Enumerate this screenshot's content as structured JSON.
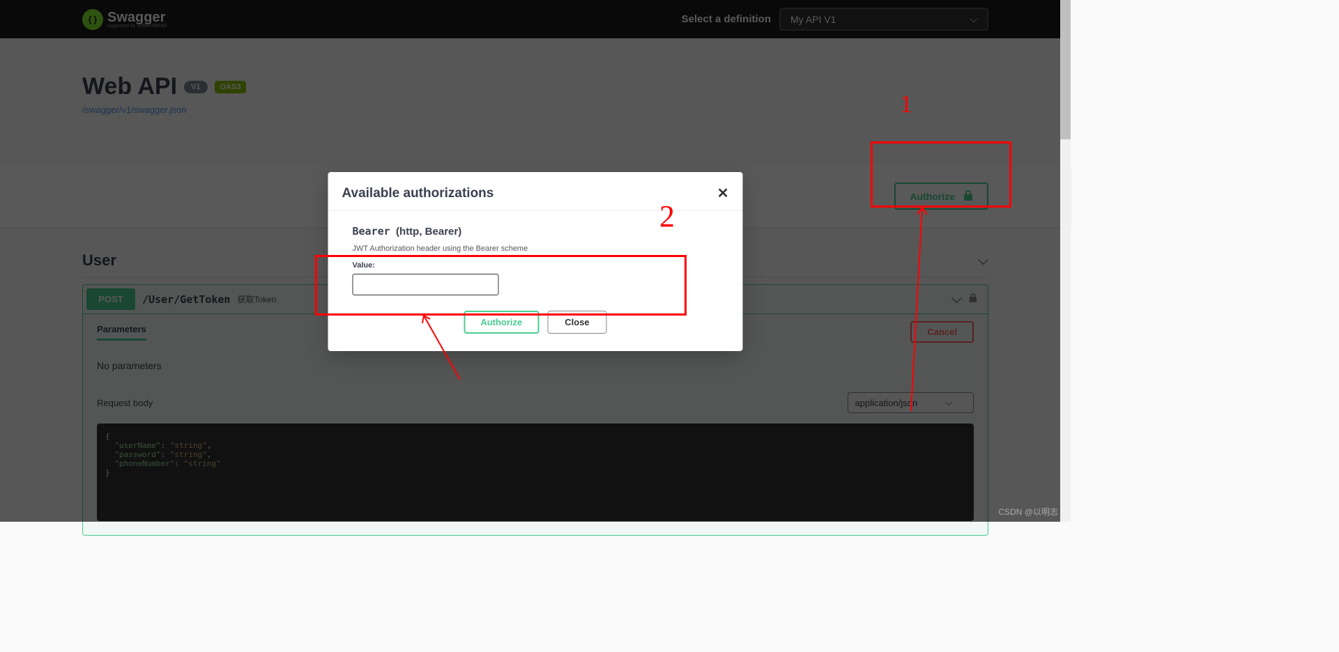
{
  "topbar": {
    "brand": "Swagger",
    "brand_sub": "supported by SMARTBEAR",
    "definition_label": "Select a definition",
    "definition_value": "My API V1"
  },
  "info": {
    "title": "Web API",
    "version_badge": "V1",
    "oas_badge": "OAS3",
    "spec_link": "/swagger/v1/swagger.json"
  },
  "authorize_button": "Authorize",
  "tag": {
    "name": "User"
  },
  "operation": {
    "method": "POST",
    "path": "/User/GetToken",
    "summary": "获取Token",
    "parameters_tab": "Parameters",
    "cancel": "Cancel",
    "no_params": "No parameters",
    "request_body_label": "Request body",
    "content_type": "application/json",
    "body_json": "{\n  \"userName\": \"string\",\n  \"password\": \"string\",\n  \"phoneNumber\": \"string\"\n}"
  },
  "modal": {
    "title": "Available authorizations",
    "scheme_name": "Bearer",
    "scheme_type": "(http, Bearer)",
    "description": "JWT Authorization header using the Bearer scheme",
    "value_label": "Value:",
    "value": "",
    "authorize_btn": "Authorize",
    "close_btn": "Close"
  },
  "annotations": {
    "label1": "1",
    "label2": "2"
  },
  "watermark": "CSDN @以明志"
}
